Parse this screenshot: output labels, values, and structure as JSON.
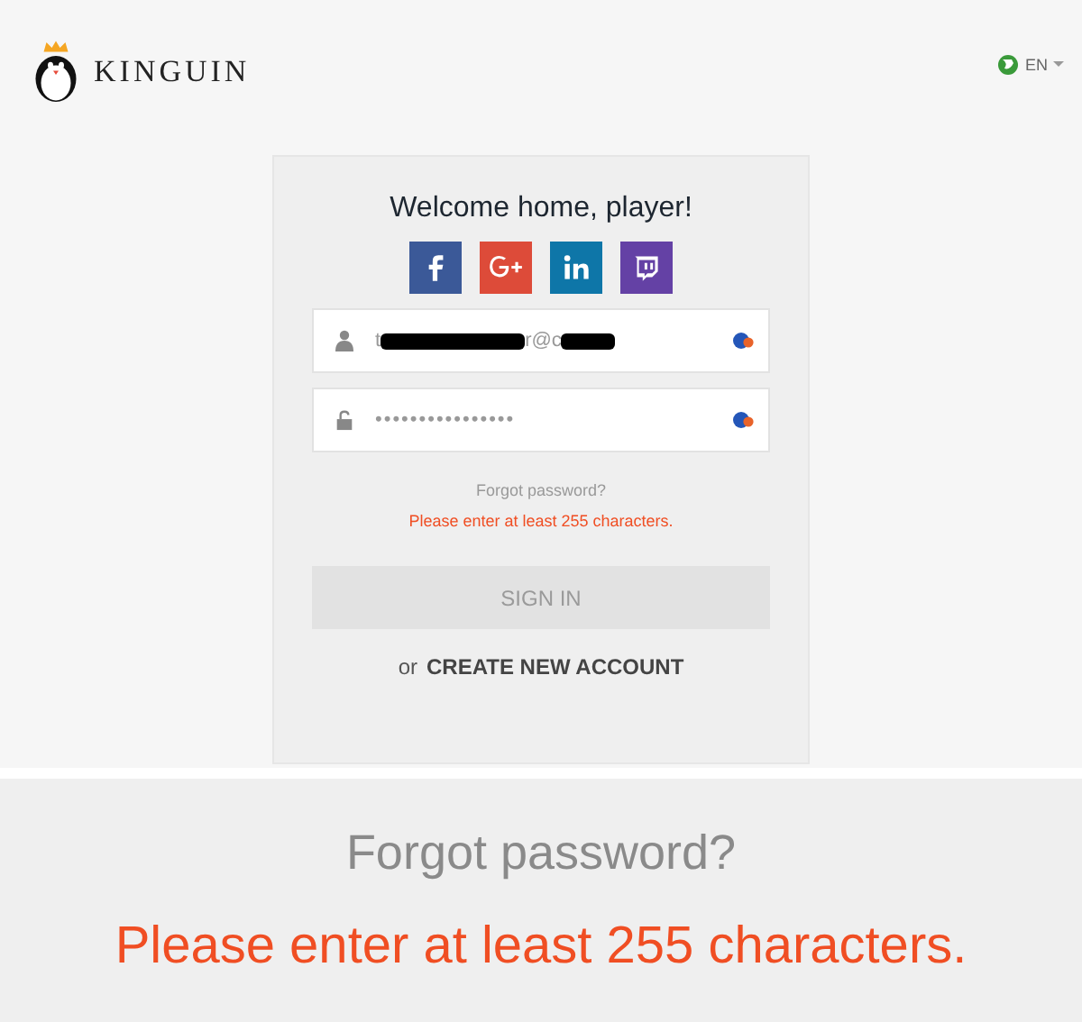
{
  "header": {
    "logo_text": "KINGUIN",
    "language": "EN"
  },
  "login": {
    "title": "Welcome home, player!",
    "social": [
      {
        "kind": "facebook",
        "color": "#3b5998"
      },
      {
        "kind": "google",
        "color": "#dd4b39"
      },
      {
        "kind": "linkedin",
        "color": "#0e76a8"
      },
      {
        "kind": "twitch",
        "color": "#6441a5"
      }
    ],
    "email": {
      "segments": [
        {
          "kind": "text",
          "text": "t"
        },
        {
          "kind": "redaction"
        },
        {
          "kind": "text",
          "text": "r@c"
        },
        {
          "kind": "redaction"
        }
      ]
    },
    "password": {
      "value": "••••••••••••••••"
    },
    "forgot_link": "Forgot password?",
    "error": "Please enter at least 255 characters.",
    "sign_in": {
      "label": "SIGN IN",
      "disabled": true
    },
    "alt_prefix": "or",
    "create_link": "CREATE NEW ACCOUNT"
  },
  "zoom_panel": {
    "forgot_link": "Forgot password?",
    "error": "Please enter at least 255 characters."
  }
}
